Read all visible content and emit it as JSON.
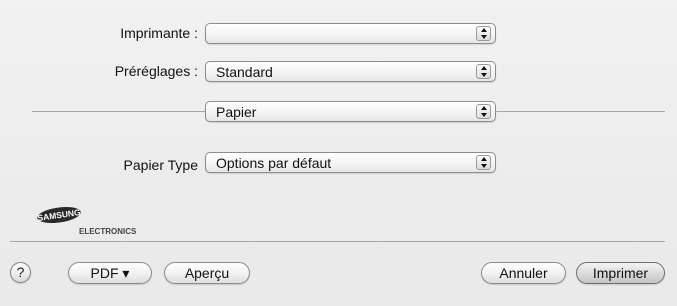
{
  "fields": {
    "printer": {
      "label": "Imprimante :",
      "value": ""
    },
    "presets": {
      "label": "Préréglages :",
      "value": "Standard"
    },
    "section": {
      "value": "Papier"
    },
    "paper_type": {
      "label": "Papier Type",
      "value": "Options par défaut"
    }
  },
  "logo": {
    "brand": "SAMSUNG",
    "sub": "ELECTRONICS"
  },
  "buttons": {
    "help": "?",
    "pdf": "PDF ▾",
    "preview": "Aperçu",
    "cancel": "Annuler",
    "print": "Imprimer"
  },
  "icons": {
    "popup_stepper": "up-down-arrows-icon",
    "help": "question-mark-icon"
  }
}
